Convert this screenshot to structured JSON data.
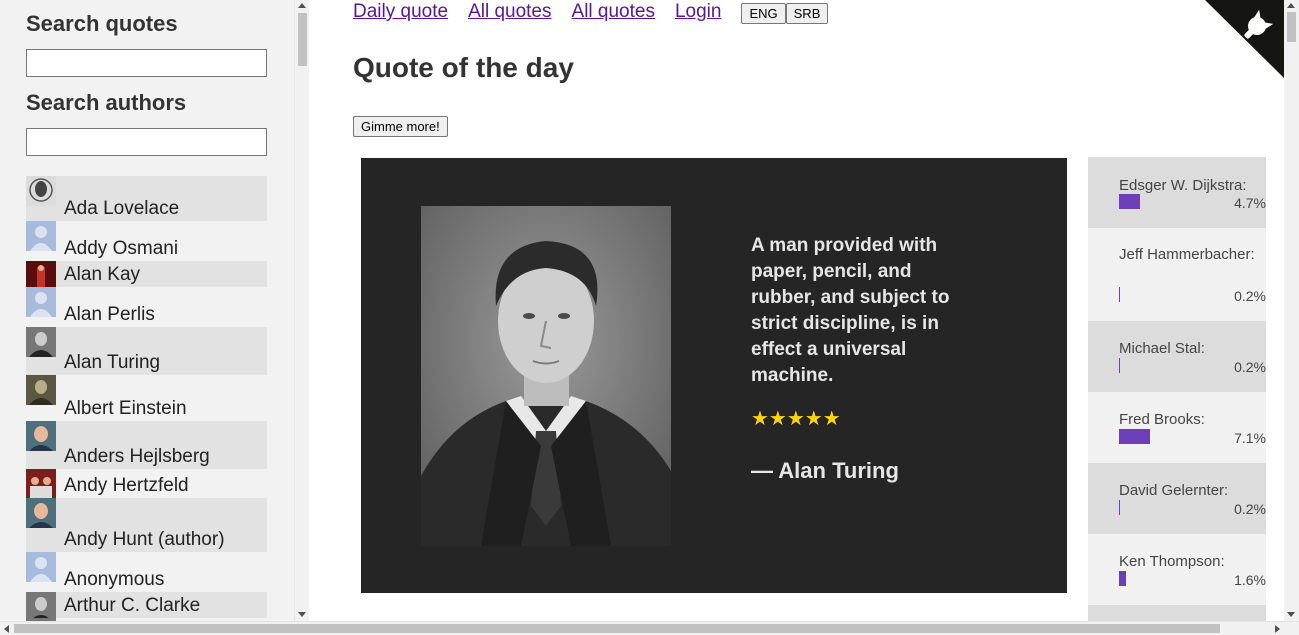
{
  "sidebar": {
    "search_quotes_title": "Search quotes",
    "search_authors_title": "Search authors",
    "authors": [
      {
        "name": "Ada Lovelace",
        "h": 45,
        "thumb": "portrait-drawing"
      },
      {
        "name": "Addy Osmani",
        "h": 40,
        "thumb": "default-avatar"
      },
      {
        "name": "Alan Kay",
        "h": 26,
        "thumb": "stage-photo"
      },
      {
        "name": "Alan Perlis",
        "h": 40,
        "thumb": "default-avatar"
      },
      {
        "name": "Alan Turing",
        "h": 48,
        "thumb": "bw-portrait"
      },
      {
        "name": "Albert Einstein",
        "h": 46,
        "thumb": "sepia-portrait"
      },
      {
        "name": "Anders Hejlsberg",
        "h": 48,
        "thumb": "color-portrait"
      },
      {
        "name": "Andy Hertzfeld",
        "h": 29,
        "thumb": "group-photo"
      },
      {
        "name": "Andy Hunt (author)",
        "h": 54,
        "thumb": "color-portrait"
      },
      {
        "name": "Anonymous",
        "h": 40,
        "thumb": "default-avatar"
      },
      {
        "name": "Arthur C. Clarke",
        "h": 26,
        "thumb": "bw-portrait"
      },
      {
        "name": "",
        "h": 12,
        "thumb": "bw-portrait"
      }
    ]
  },
  "nav": {
    "links": [
      "Daily quote",
      "All quotes",
      "All quotes",
      "Login"
    ],
    "lang_eng": "ENG",
    "lang_srb": "SRB"
  },
  "main": {
    "title": "Quote of the day",
    "more_button": "Gimme more!"
  },
  "quote": {
    "text": "A man provided with paper, pencil, and rubber, and subject to strict discipline, is in effect a universal machine.",
    "stars": "★★★★★",
    "rating": 5,
    "author": "— Alan Turing"
  },
  "votes": [
    {
      "name": "Edsger W. Dijkstra:",
      "pct": "4.7%",
      "value": 4.7
    },
    {
      "name": "Jeff Hammerbacher:",
      "pct": "0.2%",
      "value": 0.2
    },
    {
      "name": "Michael Stal:",
      "pct": "0.2%",
      "value": 0.2
    },
    {
      "name": "Fred Brooks:",
      "pct": "7.1%",
      "value": 7.1
    },
    {
      "name": "David Gelernter:",
      "pct": "0.2%",
      "value": 0.2
    },
    {
      "name": "Ken Thompson:",
      "pct": "1.6%",
      "value": 1.6
    },
    {
      "name": "",
      "pct": "",
      "value": 0
    }
  ],
  "colors": {
    "vote_bar": "#6c3fb8",
    "link": "#551a8b",
    "star": "#ffd500",
    "card_bg": "#252525"
  }
}
